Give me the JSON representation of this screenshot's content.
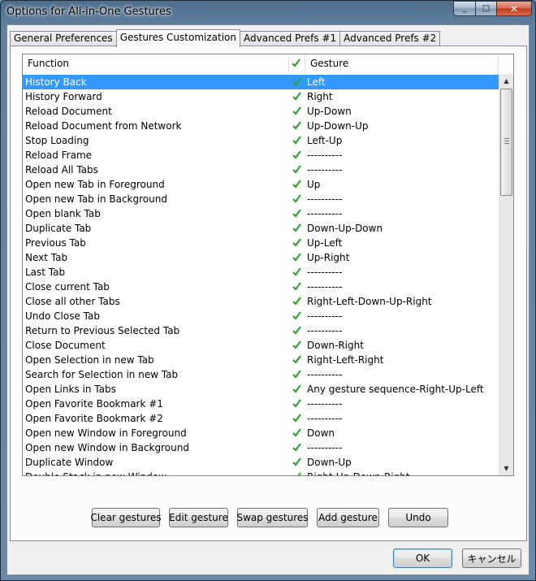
{
  "window": {
    "title": "Options for All-in-One Gestures",
    "minimize_label": "_",
    "maximize_label": "□",
    "close_label": "✕"
  },
  "tabs": [
    {
      "label": "General Preferences",
      "active": false
    },
    {
      "label": "Gestures Customization",
      "active": true
    },
    {
      "label": "Advanced Prefs #1",
      "active": false
    },
    {
      "label": "Advanced Prefs #2",
      "active": false
    }
  ],
  "list": {
    "columns": {
      "function": "Function",
      "gesture": "Gesture"
    },
    "check_color": "#2aa52a",
    "selection_color": "#3399ff",
    "rows": [
      {
        "function": "History Back",
        "gesture": "Left",
        "selected": true
      },
      {
        "function": "History Forward",
        "gesture": "Right"
      },
      {
        "function": "Reload Document",
        "gesture": "Up-Down"
      },
      {
        "function": "Reload Document from Network",
        "gesture": "Up-Down-Up"
      },
      {
        "function": "Stop Loading",
        "gesture": "Left-Up"
      },
      {
        "function": "Reload Frame",
        "gesture": "----------"
      },
      {
        "function": "Reload All Tabs",
        "gesture": "----------"
      },
      {
        "function": "Open new Tab in Foreground",
        "gesture": "Up"
      },
      {
        "function": "Open new Tab in Background",
        "gesture": "----------"
      },
      {
        "function": "Open blank Tab",
        "gesture": "----------"
      },
      {
        "function": "Duplicate Tab",
        "gesture": "Down-Up-Down"
      },
      {
        "function": "Previous Tab",
        "gesture": "Up-Left"
      },
      {
        "function": "Next Tab",
        "gesture": "Up-Right"
      },
      {
        "function": "Last Tab",
        "gesture": "----------"
      },
      {
        "function": "Close current Tab",
        "gesture": "----------"
      },
      {
        "function": "Close all other Tabs",
        "gesture": "Right-Left-Down-Up-Right"
      },
      {
        "function": "Undo Close Tab",
        "gesture": "----------"
      },
      {
        "function": "Return to Previous Selected Tab",
        "gesture": "----------"
      },
      {
        "function": "Close Document",
        "gesture": "Down-Right"
      },
      {
        "function": "Open Selection in new Tab",
        "gesture": "Right-Left-Right"
      },
      {
        "function": "Search for Selection in new Tab",
        "gesture": "----------"
      },
      {
        "function": "Open Links in Tabs",
        "gesture": "Any gesture sequence-Right-Up-Left"
      },
      {
        "function": "Open Favorite Bookmark #1",
        "gesture": "----------"
      },
      {
        "function": "Open Favorite Bookmark #2",
        "gesture": "----------"
      },
      {
        "function": "Open new Window in Foreground",
        "gesture": "Down"
      },
      {
        "function": "Open new Window in Background",
        "gesture": "----------"
      },
      {
        "function": "Duplicate Window",
        "gesture": "Down-Up"
      },
      {
        "function": "Double Stack in new Window",
        "gesture": "Right-Up-Down-Right"
      }
    ]
  },
  "actions": {
    "clear": "Clear gestures",
    "edit": "Edit gesture",
    "swap": "Swap gestures",
    "add": "Add gesture",
    "undo": "Undo"
  },
  "footer": {
    "ok": "OK",
    "cancel": "キャンセル"
  }
}
